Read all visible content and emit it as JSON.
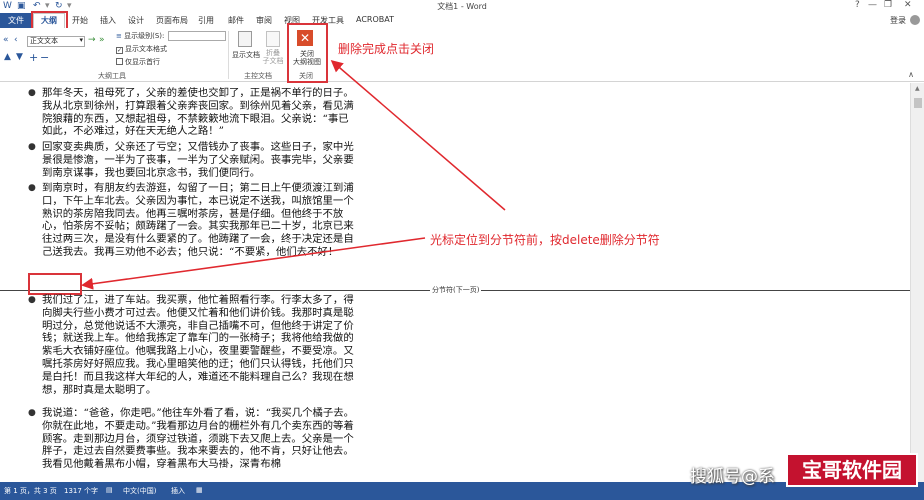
{
  "title_bar": {
    "title": "文档1 - Word",
    "help": "?",
    "minimize": "—",
    "restore": "❐",
    "close": "✕"
  },
  "tabs": [
    "文件",
    "大纲",
    "开始",
    "插入",
    "设计",
    "页面布局",
    "引用",
    "邮件",
    "审阅",
    "视图",
    "开发工具",
    "ACROBAT"
  ],
  "user": {
    "login": "登录"
  },
  "ribbon": {
    "style_value": "正文文本",
    "show_level_label": "显示级别(S):",
    "show_text_format": "显示文本格式",
    "show_first_line": "仅显示首行",
    "outline_tools_label": "大纲工具",
    "show_document": "显示文档",
    "collapse_subdoc_1": "折叠",
    "collapse_subdoc_2": "子文档",
    "master_doc_label": "主控文档",
    "close_outline_1": "关闭",
    "close_outline_2": "大纲视图",
    "close_label": "关闭"
  },
  "annotations": {
    "close_note": "删除完成点击关闭",
    "cursor_note": "光标定位到分节符前，按delete删除分节符"
  },
  "document": {
    "paragraphs_top": [
      "那年冬天，祖母死了，父亲的差使也交卸了，正是祸不单行的日子。我从北京到徐州，打算跟着父亲奔丧回家。到徐州见着父亲，看见满院狼藉的东西，又想起祖母，不禁簌簌地流下眼泪。父亲说：“事已如此，不必难过，好在天无绝人之路！”",
      "回家变卖典质，父亲还了亏空；又借钱办了丧事。这些日子，家中光景很是惨澹，一半为了丧事，一半为了父亲赋闲。丧事完毕，父亲要到南京谋事，我也要回北京念书，我们便同行。",
      "到南京时，有朋友约去游逛，勾留了一日；第二日上午便须渡江到浦口，下午上车北去。父亲因为事忙，本已说定不送我，叫旅馆里一个熟识的茶房陪我同去。他再三嘱咐茶房，甚是仔细。但他终于不放心，怕茶房不妥帖；颇踌躇了一会。其实我那年已二十岁，北京已来往过两三次，是没有什么要紧的了。他踌躇了一会，终于决定还是自己送我去。我再三劝他不必去；他只说：“不要紧，他们去不好！"
    ],
    "section_break": "分节符(下一页)",
    "paragraphs_bottom": [
      "我们过了江，进了车站。我买票，他忙着照看行李。行李太多了，得向脚夫行些小费才可过去。他便又忙着和他们讲价钱。我那时真是聪明过分，总觉他说话不大漂亮，非自己插嘴不可，但他终于讲定了价钱；就送我上车。他给我拣定了靠车门的一张椅子；我将他给我做的紫毛大衣铺好座位。他嘱我路上小心，夜里要警醒些，不要受凉。又嘱托茶房好好照应我。我心里暗笑他的迂；他们只认得钱，托他们只是白托！而且我这样大年纪的人，难道还不能料理自己么？我现在想想，那时真是太聪明了。",
      "我说道：“爸爸，你走吧。”他往车外看了看，说：“我买几个橘子去。你就在此地，不要走动。”我看那边月台的栅栏外有几个卖东西的等着顾客。走到那边月台，须穿过铁道，须跳下去又爬上去。父亲是一个胖子，走过去自然要费事些。我本来要去的，他不肯，只好让他去。我看见他戴着黑布小帽，穿着黑布大马褂，深青布棉"
    ]
  },
  "status_bar": {
    "page": "第 1 页，共 3 页",
    "words": "1317 个字",
    "language": "中文(中国)",
    "mode": "插入"
  },
  "watermark": {
    "text": "搜狐号@系",
    "badge": "宝哥软件园"
  },
  "colors": {
    "accent": "#2b579a",
    "annotation": "#e0282e",
    "close_icon": "#d84c2a"
  }
}
